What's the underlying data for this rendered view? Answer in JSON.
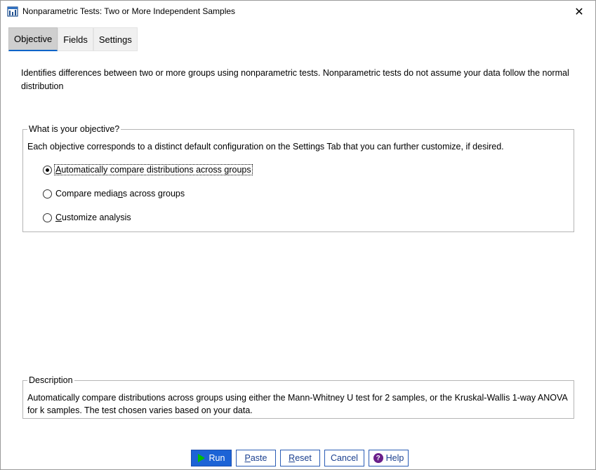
{
  "window": {
    "title": "Nonparametric Tests: Two or More Independent Samples",
    "close_glyph": "✕",
    "icon": "spss-dialog-icon"
  },
  "tabs": [
    {
      "label": "Objective",
      "active": true
    },
    {
      "label": "Fields",
      "active": false
    },
    {
      "label": "Settings",
      "active": false
    }
  ],
  "intro_text": "Identifies differences between two or more groups using nonparametric tests. Nonparametric tests do not assume your data follow the normal distribution",
  "objective": {
    "legend": "What is your objective?",
    "description": "Each objective corresponds to a distinct default configuration on the Settings Tab that you can further customize, if desired.",
    "options": [
      {
        "label_mnemonic": "A",
        "label_rest": "utomatically compare distributions across groups",
        "checked": true
      },
      {
        "label_before": "Compare media",
        "label_mnemonic": "n",
        "label_after": "s across groups",
        "checked": false
      },
      {
        "label_mnemonic": "C",
        "label_rest": "ustomize analysis",
        "checked": false
      }
    ]
  },
  "description": {
    "legend": "Description",
    "text": "Automatically compare distributions across groups using either the Mann-Whitney U test for 2 samples, or the Kruskal-Wallis 1-way ANOVA for k samples.  The test chosen varies based on your data."
  },
  "buttons": {
    "run": "Run",
    "paste_mnemonic": "P",
    "paste_rest": "aste",
    "reset_mnemonic": "R",
    "reset_rest": "eset",
    "cancel": "Cancel",
    "help": "Help",
    "help_glyph": "?"
  },
  "colors": {
    "run_bg": "#1c63d6",
    "run_icon": "#00c000",
    "tab_active_underline": "#0a64c8",
    "help_icon_bg": "#6a1f8a"
  }
}
